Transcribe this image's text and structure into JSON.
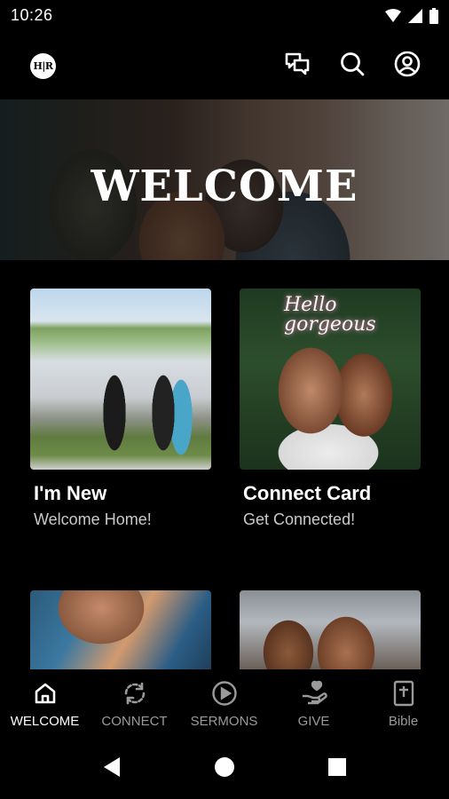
{
  "status_bar": {
    "time": "10:26"
  },
  "app_bar": {
    "logo_text": "H|R"
  },
  "hero": {
    "title": "WELCOME"
  },
  "cards": [
    {
      "title": "I'm New",
      "subtitle": "Welcome Home!"
    },
    {
      "title": "Connect Card",
      "subtitle": "Get Connected!",
      "image_text": "Hello gorgeous"
    }
  ],
  "bottom_nav": {
    "items": [
      {
        "label": "WELCOME",
        "icon": "home-icon",
        "active": true
      },
      {
        "label": "CONNECT",
        "icon": "sync-icon",
        "active": false
      },
      {
        "label": "SERMONS",
        "icon": "play-circle-icon",
        "active": false
      },
      {
        "label": "GIVE",
        "icon": "giving-hand-icon",
        "active": false
      },
      {
        "label": "Bible",
        "icon": "bible-icon",
        "active": false
      }
    ]
  },
  "colors": {
    "background": "#000000",
    "text": "#ffffff",
    "inactive": "#9a9a9a"
  }
}
